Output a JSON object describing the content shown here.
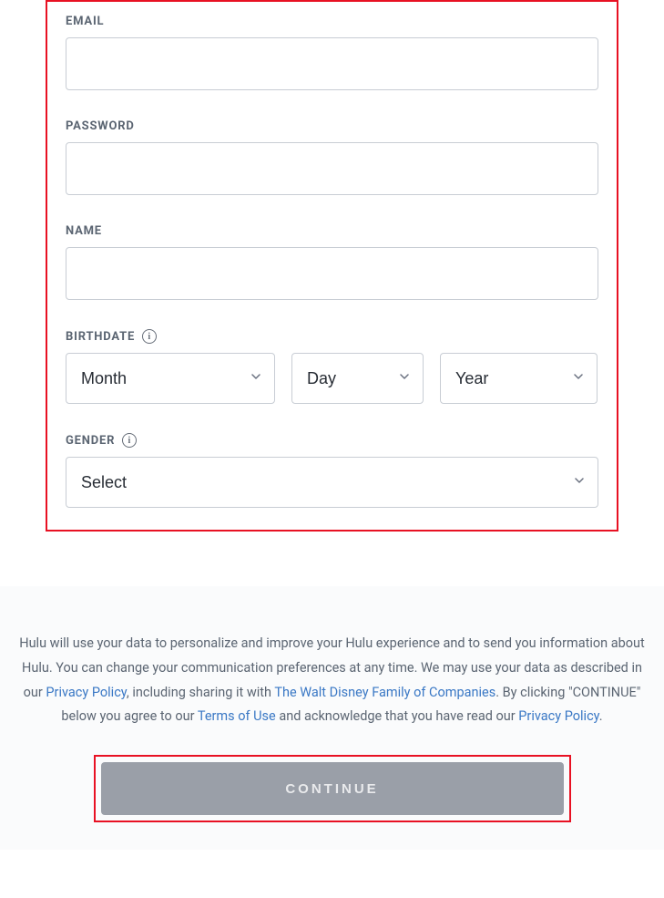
{
  "form": {
    "email": {
      "label": "EMAIL",
      "value": ""
    },
    "password": {
      "label": "PASSWORD",
      "value": ""
    },
    "name": {
      "label": "NAME",
      "value": ""
    },
    "birthdate": {
      "label": "BIRTHDATE",
      "month": {
        "placeholder": "Month"
      },
      "day": {
        "placeholder": "Day"
      },
      "year": {
        "placeholder": "Year"
      }
    },
    "gender": {
      "label": "GENDER",
      "placeholder": "Select"
    }
  },
  "legal": {
    "text1": "Hulu will use your data to personalize and improve your Hulu experience and to send you information about Hulu. You can change your communication preferences at any time. We may use your data as described in our ",
    "privacy_link": "Privacy Policy",
    "text2": ", including sharing it with ",
    "disney_link": "The Walt Disney Family of Companies",
    "text3": ". By clicking \"CONTINUE\" below you agree to our ",
    "terms_link": "Terms of Use",
    "text4": " and acknowledge that you have read our ",
    "privacy_link2": "Privacy Policy",
    "text5": "."
  },
  "continue_button": "CONTINUE",
  "icons": {
    "info": "i"
  }
}
